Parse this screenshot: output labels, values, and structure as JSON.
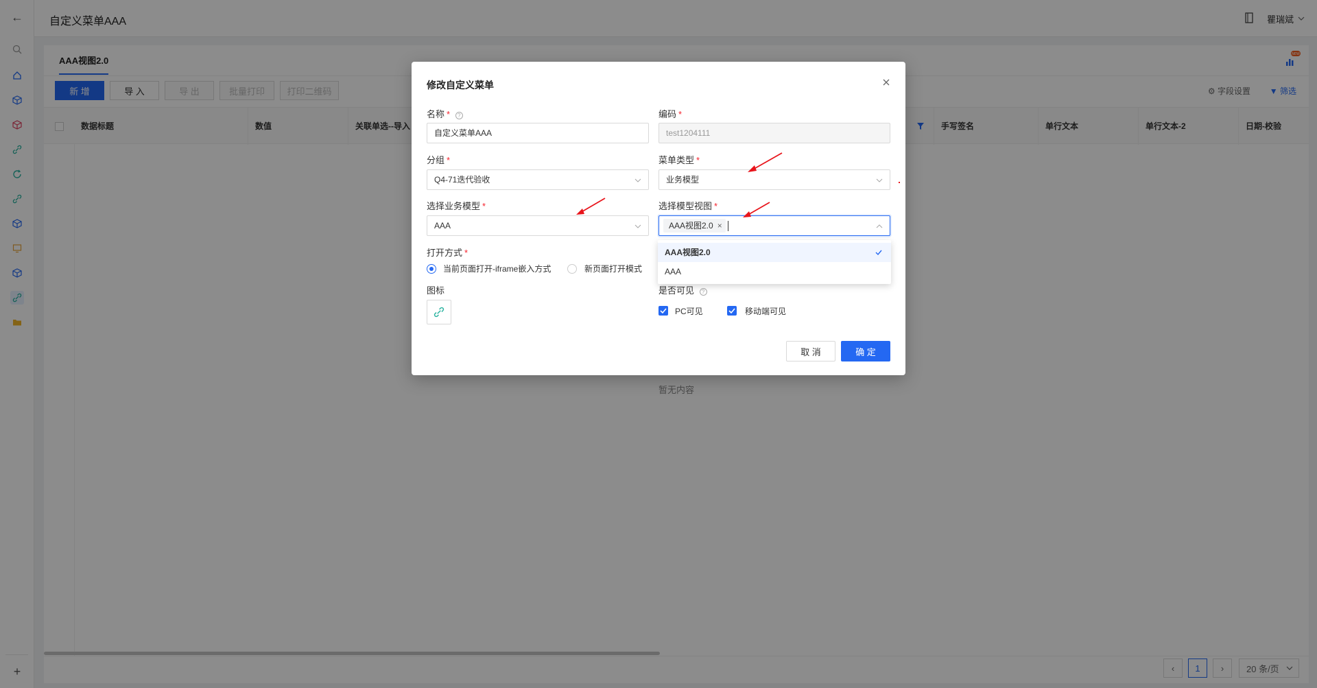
{
  "app": {
    "title": "自定义菜单AAA",
    "user_name": "瞿瑞斌"
  },
  "view": {
    "tab_label": "AAA视图2.0",
    "toolbar": {
      "new_label": "新 增",
      "import_label": "导 入",
      "export_label": "导 出",
      "batch_print_label": "批量打印",
      "print_qr_label": "打印二维码",
      "field_settings_label": "字段设置",
      "filter_label": "筛选"
    },
    "columns": [
      "数据标题",
      "数值",
      "关联单选--导入",
      "手写签名",
      "单行文本",
      "单行文本-2",
      "日期-校验"
    ],
    "empty_text": "暂无内容",
    "pager": {
      "current_page": "1",
      "page_size": "20 条/页"
    }
  },
  "modal": {
    "title": "修改自定义菜单",
    "name": {
      "label": "名称",
      "value": "自定义菜单AAA"
    },
    "code": {
      "label": "编码",
      "value": "test1204111"
    },
    "group": {
      "label": "分组",
      "value": "Q4-71迭代验收"
    },
    "menu_type": {
      "label": "菜单类型",
      "value": "业务模型"
    },
    "business_model": {
      "label": "选择业务模型",
      "value": "AAA"
    },
    "model_view": {
      "label": "选择模型视图",
      "selected_tag": "AAA视图2.0",
      "options": [
        {
          "label": "AAA视图2.0",
          "selected": true
        },
        {
          "label": "AAA",
          "selected": false
        }
      ]
    },
    "open_mode": {
      "label": "打开方式",
      "options": [
        "当前页面打开-iframe嵌入方式",
        "新页面打开模式"
      ],
      "selected_index": 0
    },
    "icon": {
      "label": "图标",
      "name": "link-icon"
    },
    "visibility": {
      "label": "是否可见",
      "pc_label": "PC可见",
      "mobile_label": "移动端可见",
      "pc_checked": true,
      "mobile_checked": true
    },
    "cancel_label": "取 消",
    "confirm_label": "确 定"
  },
  "colors": {
    "primary": "#2468f2",
    "required": "#f5222d",
    "annotation_arrow": "#e8141b"
  }
}
